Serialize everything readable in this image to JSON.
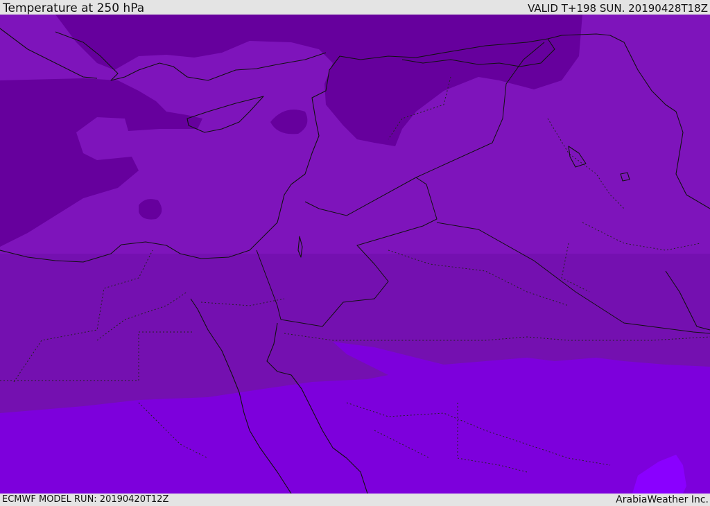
{
  "header": {
    "title": "Temperature at 250 hPa",
    "valid": "VALID T+198 SUN. 20190428T18Z"
  },
  "footer": {
    "model_run": "ECMWF MODEL RUN: 20190420T12Z",
    "credit": "ArabiaWeather Inc."
  },
  "map": {
    "field": "temperature",
    "level": "250 hPa",
    "palette": {
      "darkest": "#66009d",
      "dark": "#7410b0",
      "mid": "#7e14bb",
      "light": "#7d00dc",
      "lightest": "#8a00ff"
    }
  }
}
